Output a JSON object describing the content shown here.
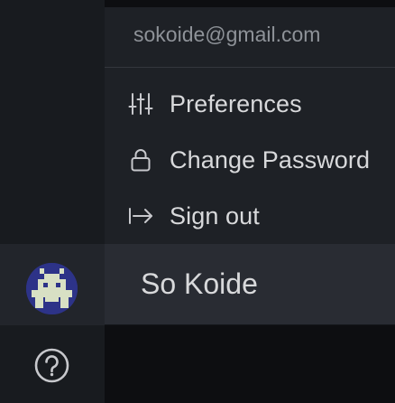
{
  "sidenav": {
    "avatar_icon": "pixel-invader-avatar",
    "help_icon": "question-circle-icon"
  },
  "profile_menu": {
    "email": "sokoide@gmail.com",
    "items": [
      {
        "label": "Preferences",
        "icon": "sliders-icon"
      },
      {
        "label": "Change Password",
        "icon": "lock-icon"
      },
      {
        "label": "Sign out",
        "icon": "sign-out-arrow-icon"
      }
    ],
    "user_name": "So Koide"
  },
  "colors": {
    "sidenav_bg": "#181b1f",
    "menu_bg": "#1e2126",
    "menu_header_bg": "#292c33",
    "avatar_bg": "#2d3388",
    "text_primary": "#d8d9db",
    "text_secondary": "#8e9298"
  }
}
